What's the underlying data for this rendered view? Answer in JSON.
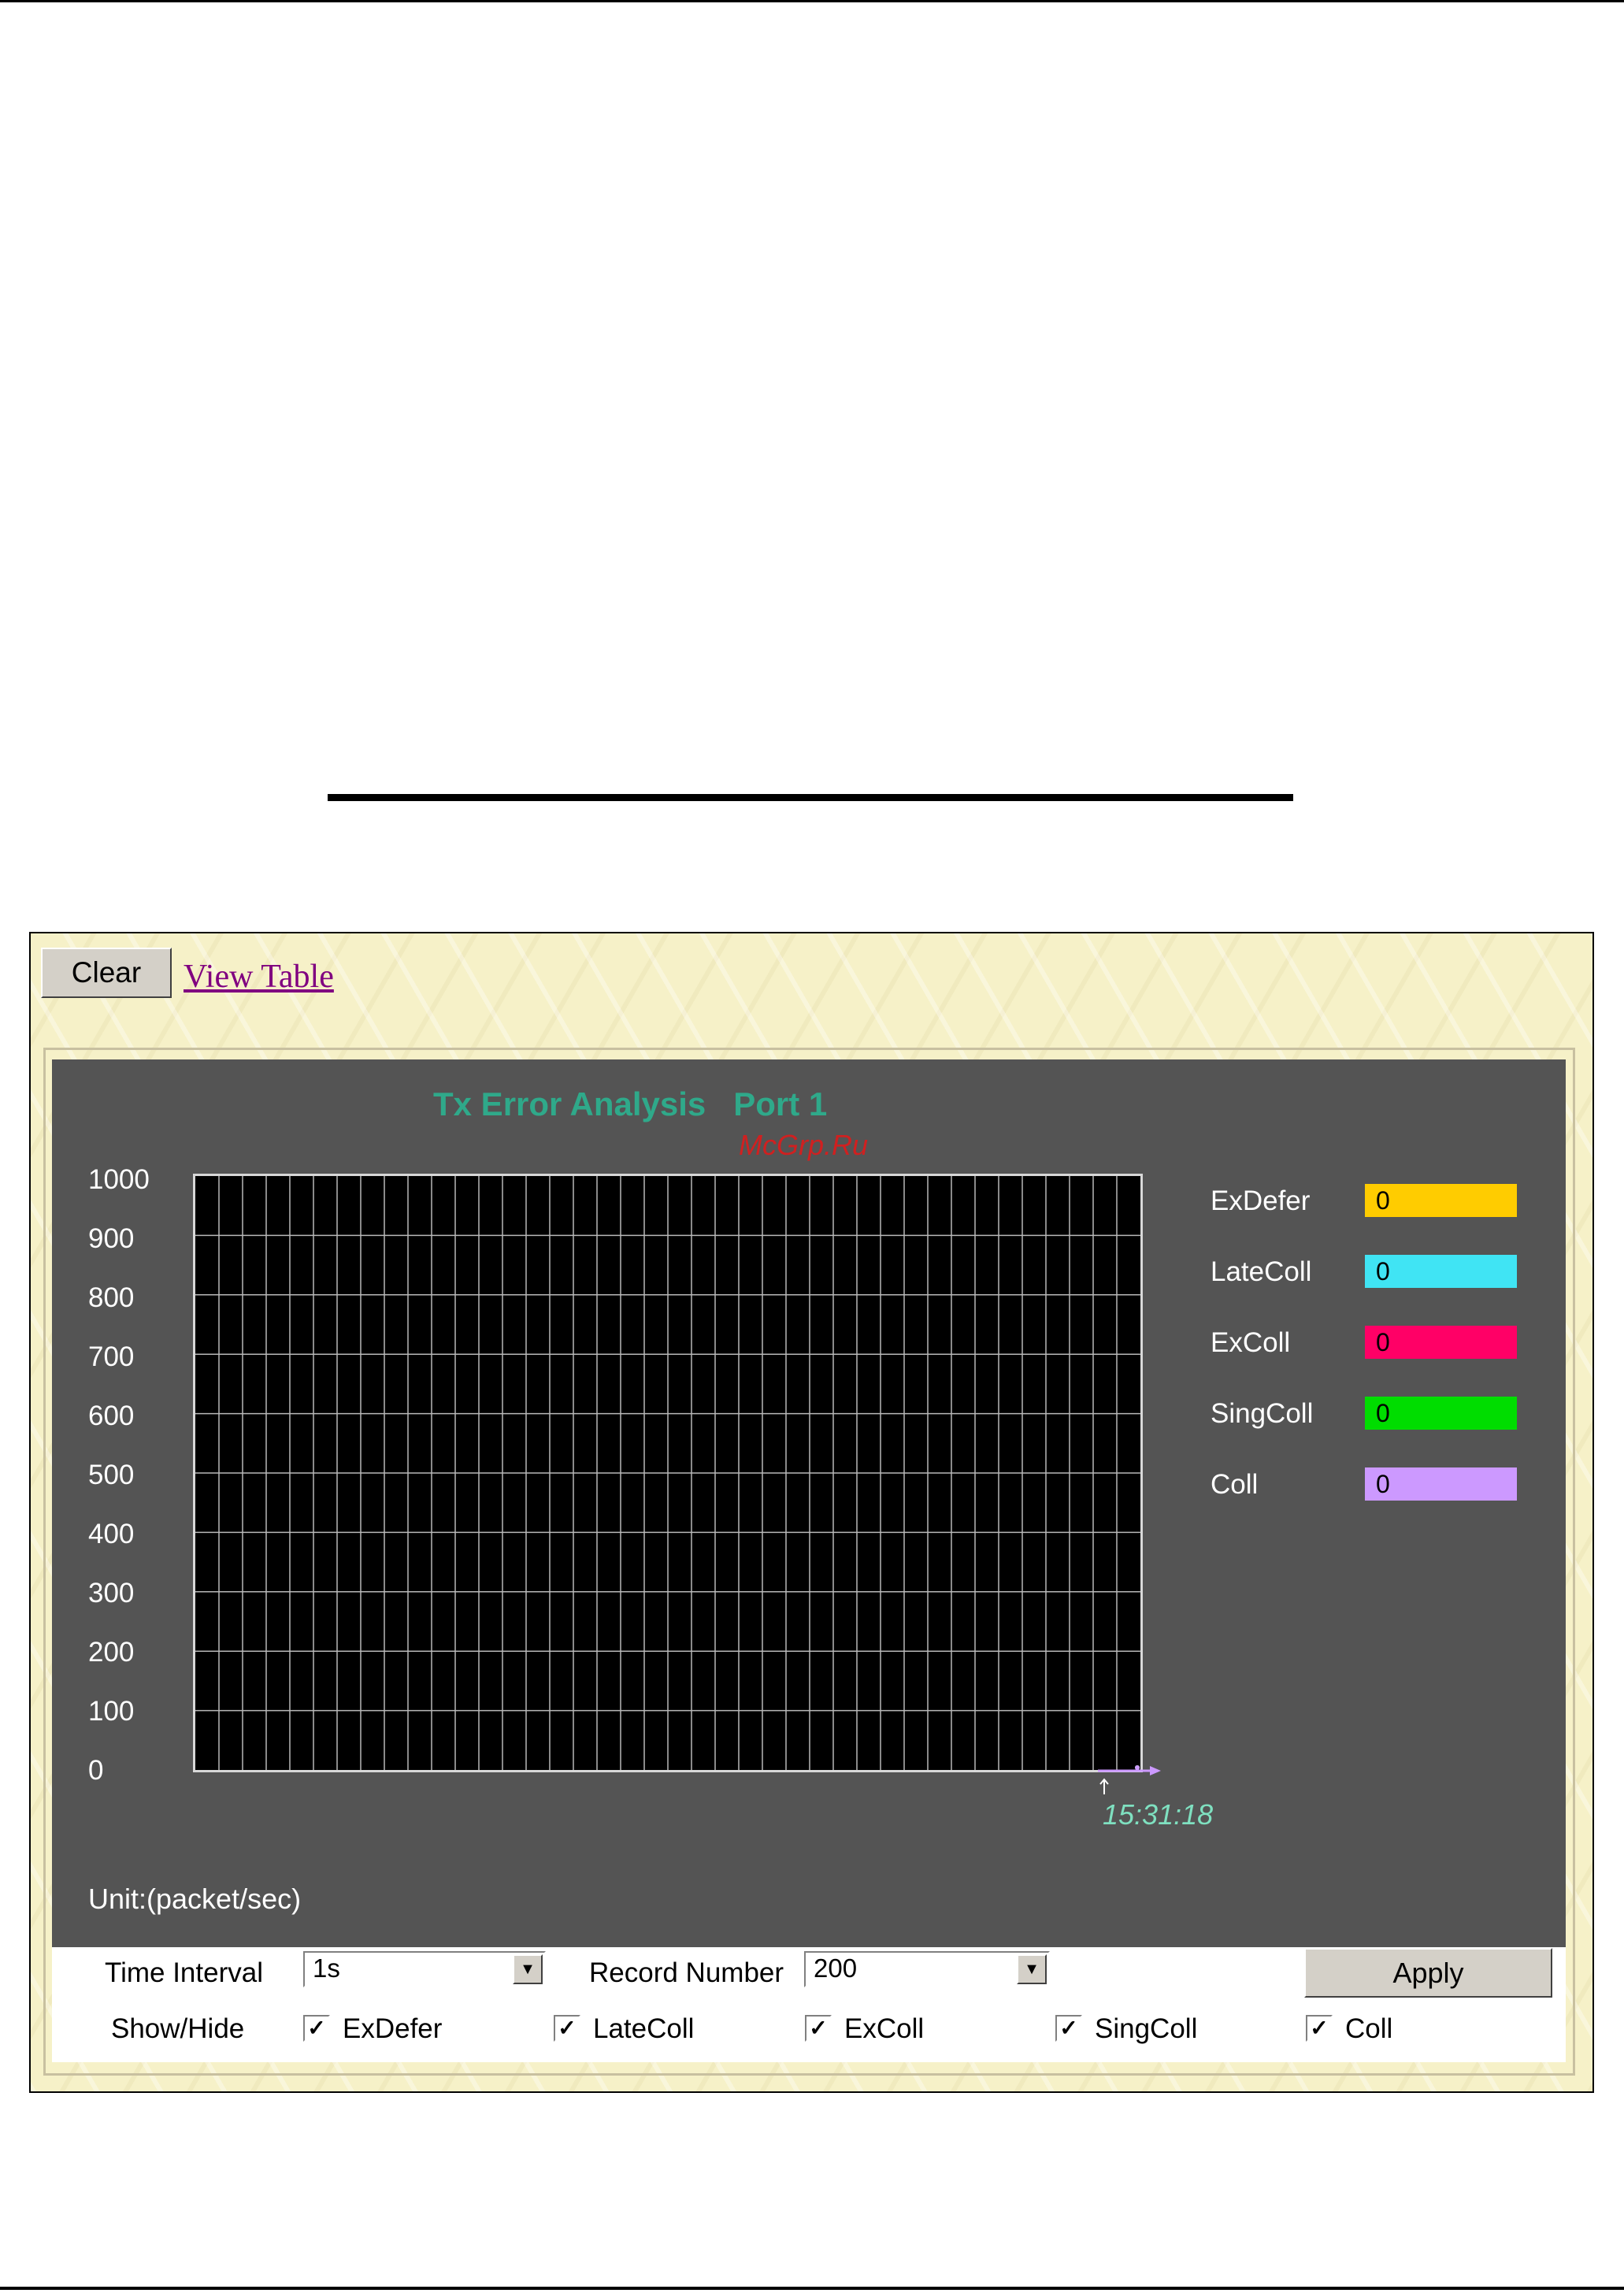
{
  "toolbar": {
    "clear_label": "Clear",
    "view_table_label": "View Table"
  },
  "graph": {
    "title": "Tx Error Analysis   Port 1",
    "watermark": "McGrp.Ru",
    "unit": "Unit:(packet/sec)",
    "time_label": "15:31:18"
  },
  "chart_data": {
    "type": "line",
    "title": "Tx Error Analysis   Port 1",
    "ylabel": "Unit:(packet/sec)",
    "ylim": [
      0,
      1000
    ],
    "yticks": [
      "1000",
      "900",
      "800",
      "700",
      "600",
      "500",
      "400",
      "300",
      "200",
      "100",
      "0"
    ],
    "x": [
      "15:31:18"
    ],
    "grid": true,
    "legend_position": "right",
    "series": [
      {
        "name": "ExDefer",
        "values": [
          0
        ],
        "color": "#ffcc00"
      },
      {
        "name": "LateColl",
        "values": [
          0
        ],
        "color": "#40e4f4"
      },
      {
        "name": "ExColl",
        "values": [
          0
        ],
        "color": "#ff0066"
      },
      {
        "name": "SingColl",
        "values": [
          0
        ],
        "color": "#00dd00"
      },
      {
        "name": "Coll",
        "values": [
          0
        ],
        "color": "#cc99ff"
      }
    ]
  },
  "legend": [
    {
      "label": "ExDefer",
      "value": "0",
      "color": "#ffcc00"
    },
    {
      "label": "LateColl",
      "value": "0",
      "color": "#40e4f4"
    },
    {
      "label": "ExColl",
      "value": "0",
      "color": "#ff0066"
    },
    {
      "label": "SingColl",
      "value": "0",
      "color": "#00dd00"
    },
    {
      "label": "Coll",
      "value": "0",
      "color": "#cc99ff"
    }
  ],
  "controls": {
    "time_interval_label": "Time Interval",
    "time_interval_value": "1s",
    "record_number_label": "Record Number",
    "record_number_value": "200",
    "apply_label": "Apply",
    "show_hide_label": "Show/Hide",
    "checkboxes": [
      {
        "label": "ExDefer",
        "checked": true
      },
      {
        "label": "LateColl",
        "checked": true
      },
      {
        "label": "ExColl",
        "checked": true
      },
      {
        "label": "SingColl",
        "checked": true
      },
      {
        "label": "Coll",
        "checked": true
      }
    ]
  }
}
